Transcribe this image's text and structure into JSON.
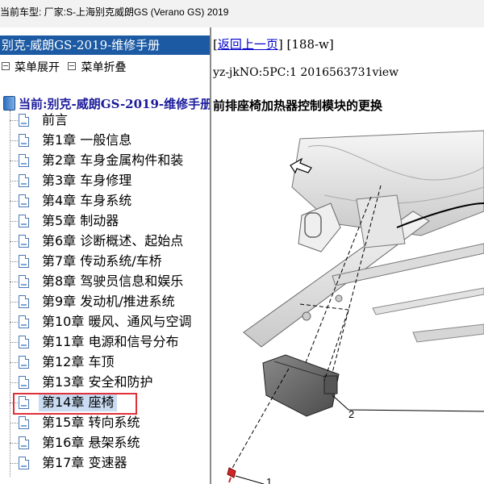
{
  "window": {
    "title": "当前车型:  厂家:S-上海别克威朗GS (Verano GS) 2019"
  },
  "sidebar": {
    "header": "别克-威朗GS-2019-维修手册",
    "expand_label": "菜单展开",
    "collapse_label": "菜单折叠",
    "root_label": "当前:别克-威朗GS-2019-维修手册",
    "items": [
      {
        "label": "前言"
      },
      {
        "label": "第1章 一般信息"
      },
      {
        "label": "第2章 车身金属构件和装"
      },
      {
        "label": "第3章 车身修理"
      },
      {
        "label": "第4章 车身系统"
      },
      {
        "label": "第5章 制动器"
      },
      {
        "label": "第6章 诊断概述、起始点"
      },
      {
        "label": "第7章 传动系统/车桥"
      },
      {
        "label": "第8章 驾驶员信息和娱乐"
      },
      {
        "label": "第9章 发动机/推进系统"
      },
      {
        "label": "第10章 暖风、通风与空调"
      },
      {
        "label": "第11章 电源和信号分布"
      },
      {
        "label": "第12章 车顶"
      },
      {
        "label": "第13章 安全和防护"
      },
      {
        "label": "第14章 座椅",
        "selected": true
      },
      {
        "label": "第15章 转向系统"
      },
      {
        "label": "第16章 悬架系统"
      },
      {
        "label": "第17章 变速器"
      }
    ]
  },
  "content": {
    "back_link": "返回上一页",
    "page_code": "[188-w]",
    "doc_id": "yz-jkNO:5PC:1 2016563731view",
    "title": "前排座椅加热器控制模块的更换",
    "callouts": [
      "2",
      "1"
    ]
  },
  "colors": {
    "header_bg": "#1c5aa3",
    "selection_border": "#e0303a",
    "link": "#0000cc"
  }
}
